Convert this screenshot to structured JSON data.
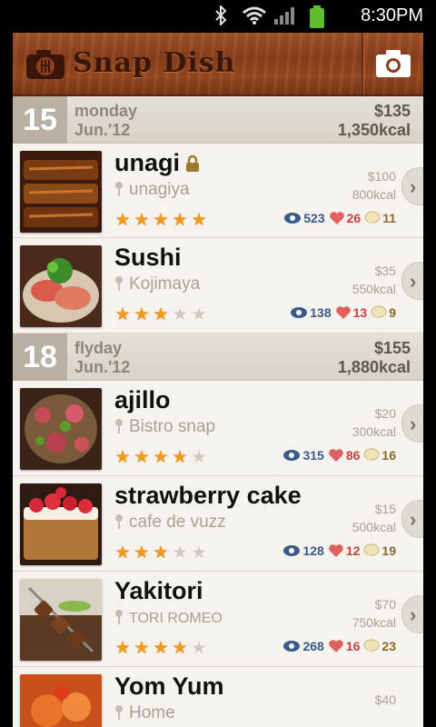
{
  "status_bar": {
    "time": "8:30PM",
    "icons": [
      "bluetooth-icon",
      "wifi-icon",
      "signal-icon",
      "battery-icon"
    ]
  },
  "header": {
    "app_name": "Snap Dish",
    "logo_icon": "camera-fork-logo",
    "camera_button_icon": "camera-icon",
    "colors": {
      "wood": "#8a3f1c",
      "logo_text": "#3a1608"
    }
  },
  "days": [
    {
      "day_number": "15",
      "weekday": "monday",
      "date": "Jun.'12",
      "total_cost": "$135",
      "total_kcal": "1,350kcal",
      "items": [
        {
          "name": "unagi",
          "locked": true,
          "place": "unagiya",
          "price": "$100",
          "kcal": "800kcal",
          "rating": 5,
          "views": "523",
          "likes": "26",
          "comments": "11"
        },
        {
          "name": "Sushi",
          "locked": false,
          "place": "Kojimaya",
          "price": "$35",
          "kcal": "550kcal",
          "rating": 3,
          "views": "138",
          "likes": "13",
          "comments": "9"
        }
      ]
    },
    {
      "day_number": "18",
      "weekday": "flyday",
      "date": "Jun.'12",
      "total_cost": "$155",
      "total_kcal": "1,880kcal",
      "items": [
        {
          "name": "ajillo",
          "locked": false,
          "place": "Bistro snap",
          "price": "$20",
          "kcal": "300kcal",
          "rating": 4,
          "views": "315",
          "likes": "86",
          "comments": "16"
        },
        {
          "name": "strawberry cake",
          "locked": false,
          "place": "cafe de vuzz",
          "price": "$15",
          "kcal": "500kcal",
          "rating": 3,
          "views": "128",
          "likes": "12",
          "comments": "19"
        },
        {
          "name": "Yakitori",
          "locked": false,
          "place": "TORI ROMEO",
          "price": "$70",
          "kcal": "750kcal",
          "rating": 4,
          "views": "268",
          "likes": "16",
          "comments": "23"
        },
        {
          "name": "Yom Yum",
          "locked": false,
          "place": "Home",
          "price": "$40",
          "kcal": "",
          "rating": 0,
          "views": "",
          "likes": "",
          "comments": ""
        }
      ]
    }
  ],
  "colors": {
    "star_on": "#f39a1a",
    "star_off": "#cfcac0",
    "views": "#3b5a8c",
    "likes": "#c94040",
    "comments": "#8a6a2a"
  }
}
